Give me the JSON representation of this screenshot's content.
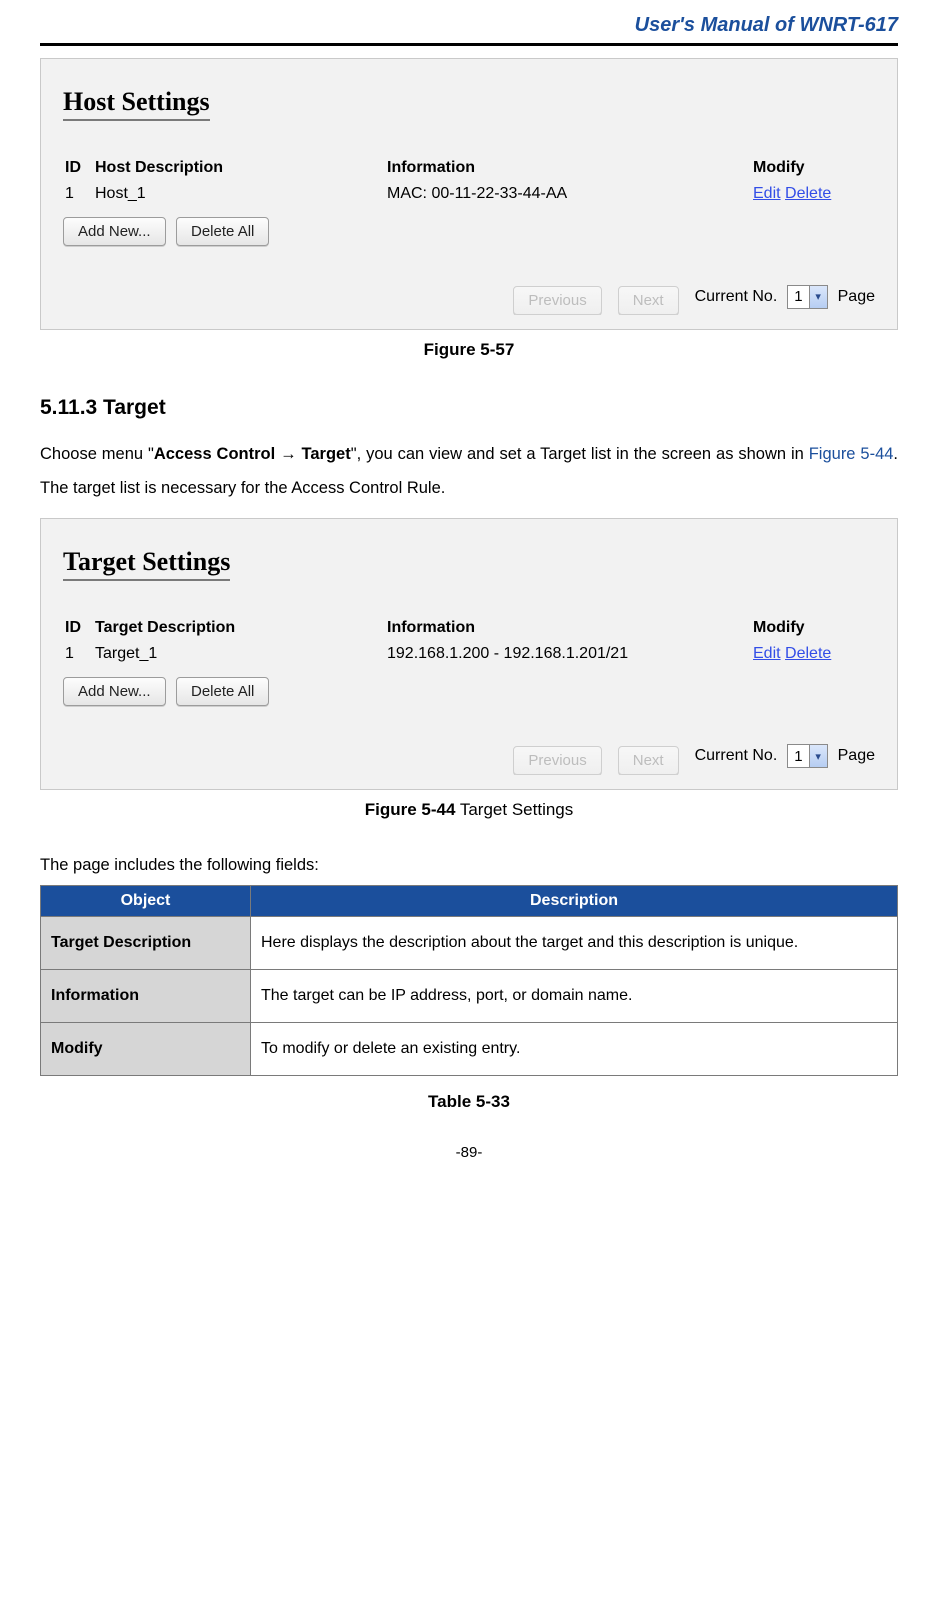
{
  "header": {
    "title": "User's Manual of WNRT-617"
  },
  "fig1": {
    "panel_title": "Host Settings",
    "cols": {
      "id": "ID",
      "desc": "Host Description",
      "info": "Information",
      "mod": "Modify"
    },
    "row": {
      "id": "1",
      "desc": "Host_1",
      "info": "MAC: 00-11-22-33-44-AA",
      "edit": "Edit",
      "delete": "Delete"
    },
    "buttons": {
      "add": "Add New...",
      "delall": "Delete All"
    },
    "pager": {
      "prev": "Previous",
      "next": "Next",
      "label": "Current No.",
      "value": "1",
      "suffix": "Page"
    },
    "caption": "Figure 5-57"
  },
  "section": {
    "heading": "5.11.3  Target",
    "para_a": "Choose menu \"",
    "para_b": "Access Control → Target",
    "para_c": "\", you can view and set a Target list in the screen as shown in ",
    "para_ref": "Figure 5-44",
    "para_d": ". The target list is necessary for the Access Control Rule."
  },
  "fig2": {
    "panel_title": "Target Settings",
    "cols": {
      "id": "ID",
      "desc": "Target Description",
      "info": "Information",
      "mod": "Modify"
    },
    "row": {
      "id": "1",
      "desc": "Target_1",
      "info": "192.168.1.200 - 192.168.1.201/21",
      "edit": "Edit",
      "delete": "Delete"
    },
    "buttons": {
      "add": "Add New...",
      "delall": "Delete All"
    },
    "pager": {
      "prev": "Previous",
      "next": "Next",
      "label": "Current No.",
      "value": "1",
      "suffix": "Page"
    },
    "caption_bold": "Figure 5-44",
    "caption_rest": "    Target Settings"
  },
  "fields": {
    "intro": "The page includes the following fields:",
    "head_obj": "Object",
    "head_desc": "Description",
    "rows": [
      {
        "obj": "Target Description",
        "desc": "Here displays the description about the target and this description is unique."
      },
      {
        "obj": "Information",
        "desc": "The target can be IP address, port, or domain name."
      },
      {
        "obj": "Modify",
        "desc": "To modify or delete an existing entry."
      }
    ],
    "caption": "Table 5-33"
  },
  "pageno": "-89-"
}
